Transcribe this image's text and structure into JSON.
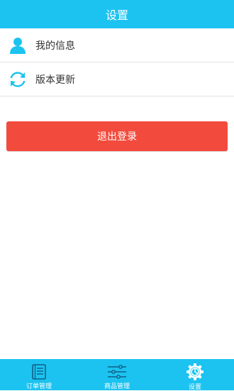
{
  "header": {
    "title": "设置"
  },
  "menu": {
    "items": [
      {
        "label": "我的信息",
        "icon": "user-icon"
      },
      {
        "label": "版本更新",
        "icon": "refresh-icon"
      }
    ]
  },
  "logout": {
    "label": "退出登录"
  },
  "tabbar": {
    "tabs": [
      {
        "label": "订单管理",
        "icon": "order-list-icon"
      },
      {
        "label": "商品管理",
        "icon": "sliders-icon"
      },
      {
        "label": "设置",
        "icon": "gear-icon",
        "active": true
      }
    ]
  },
  "colors": {
    "primary": "#1cc3f0",
    "danger": "#f24b3d",
    "divider": "#e2e2e2"
  }
}
